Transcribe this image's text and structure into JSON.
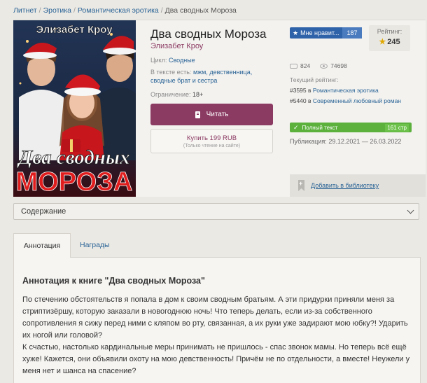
{
  "breadcrumb": {
    "items": [
      "Литнет",
      "Эротика",
      "Романтическая эротика"
    ],
    "current": "Два сводных Мороза"
  },
  "cover": {
    "author_text": "Элизабет Кроу",
    "title_line1": "Два сводных",
    "title_line2": "МОРОЗА"
  },
  "book": {
    "title": "Два сводных Мороза",
    "author": "Элизабет Кроу",
    "cycle_label": "Цикл:",
    "cycle_value": "Сводные",
    "tags_label": "В тексте есть:",
    "tags_value": "мжм, девственница, сводные брат и сестра",
    "limit_label": "Ограничение:",
    "limit_value": "18+",
    "read_button": "Читать",
    "buy_button": "Купить 199 RUB",
    "buy_note": "(Только чтение на сайте)"
  },
  "sidebar": {
    "like_label": "Мне нравит...",
    "like_count": "187",
    "rating_label": "Рейтинг:",
    "rating_value": "245",
    "comments_count": "824",
    "views_count": "74698",
    "current_rating_label": "Текущий рейтинг:",
    "rank1_position": "#3595",
    "rank1_in": "в",
    "rank1_genre": "Романтическая эротика",
    "rank2_position": "#5440",
    "rank2_in": "в",
    "rank2_genre": "Современный любовный роман",
    "progress_label": "Полный текст",
    "progress_pages": "161 стр",
    "published_label": "Публикация:",
    "published_value": "29.12.2021 — 26.03.2022",
    "library_label": "Добавить в библиотеку"
  },
  "contents": {
    "label": "Содержание"
  },
  "tabs": [
    {
      "label": "Аннотация"
    },
    {
      "label": "Награды"
    }
  ],
  "annotation": {
    "title": "Аннотация к книге \"Два сводных Мороза\"",
    "paragraph1": "По стечению обстоятельств я попала в дом к своим сводным братьям. А эти придурки приняли меня за стриптизёршу, которую заказали в новогоднюю ночь! Что теперь делать, если из-за собственного сопротивления я сижу перед ними с кляпом во рту, связанная, а их руки уже задирают мою юбку?! Ударить их ногой или головой?",
    "paragraph2": "К счастью, настолько кардинальные меры принимать не пришлось - спас звонок мамы. Но теперь всё ещё хуже! Кажется, они объявили охоту на мою девственность! Причём не по отдельности, а вместе! Неужели у меня нет и шанса на спасение?"
  },
  "colors": {
    "accent": "#8b3a62",
    "like": "#2e62a9",
    "progress": "#5cb13d",
    "link": "#2a6496"
  }
}
